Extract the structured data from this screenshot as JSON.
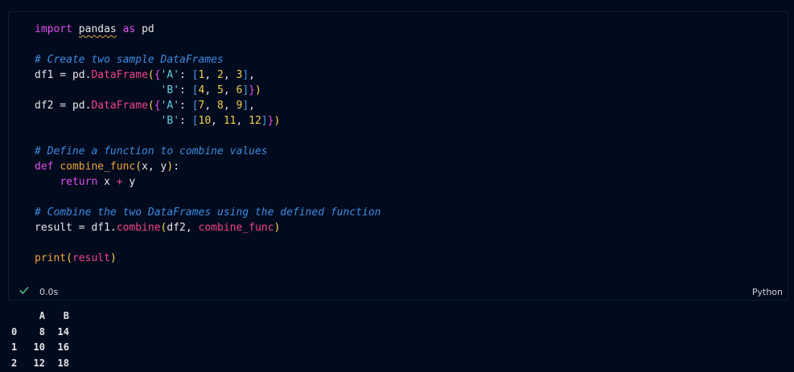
{
  "cell": {
    "code_lines": [
      [
        {
          "t": "import",
          "c": "kw"
        },
        {
          "t": " ",
          "c": "op"
        },
        {
          "t": "pandas",
          "c": "op squig"
        },
        {
          "t": " ",
          "c": "op"
        },
        {
          "t": "as",
          "c": "kw"
        },
        {
          "t": " pd",
          "c": "op"
        }
      ],
      [],
      [
        {
          "t": "# Create two sample DataFrames",
          "c": "cm"
        }
      ],
      [
        {
          "t": "df1 = pd.",
          "c": "op"
        },
        {
          "t": "DataFrame",
          "c": "mt"
        },
        {
          "t": "(",
          "c": "br1"
        },
        {
          "t": "{",
          "c": "br2"
        },
        {
          "t": "'A'",
          "c": "st"
        },
        {
          "t": ": ",
          "c": "op"
        },
        {
          "t": "[",
          "c": "br3"
        },
        {
          "t": "1",
          "c": "nu"
        },
        {
          "t": ", ",
          "c": "op"
        },
        {
          "t": "2",
          "c": "nu"
        },
        {
          "t": ", ",
          "c": "op"
        },
        {
          "t": "3",
          "c": "nu"
        },
        {
          "t": "]",
          "c": "br3"
        },
        {
          "t": ",",
          "c": "op"
        }
      ],
      [
        {
          "t": "                    ",
          "c": "op"
        },
        {
          "t": "'B'",
          "c": "st"
        },
        {
          "t": ": ",
          "c": "op"
        },
        {
          "t": "[",
          "c": "br3"
        },
        {
          "t": "4",
          "c": "nu"
        },
        {
          "t": ", ",
          "c": "op"
        },
        {
          "t": "5",
          "c": "nu"
        },
        {
          "t": ", ",
          "c": "op"
        },
        {
          "t": "6",
          "c": "nu"
        },
        {
          "t": "]",
          "c": "br3"
        },
        {
          "t": "}",
          "c": "br2"
        },
        {
          "t": ")",
          "c": "br1"
        }
      ],
      [
        {
          "t": "df2 = pd.",
          "c": "op"
        },
        {
          "t": "DataFrame",
          "c": "mt"
        },
        {
          "t": "(",
          "c": "br1"
        },
        {
          "t": "{",
          "c": "br2"
        },
        {
          "t": "'A'",
          "c": "st"
        },
        {
          "t": ": ",
          "c": "op"
        },
        {
          "t": "[",
          "c": "br3"
        },
        {
          "t": "7",
          "c": "nu"
        },
        {
          "t": ", ",
          "c": "op"
        },
        {
          "t": "8",
          "c": "nu"
        },
        {
          "t": ", ",
          "c": "op"
        },
        {
          "t": "9",
          "c": "nu"
        },
        {
          "t": "]",
          "c": "br3"
        },
        {
          "t": ",",
          "c": "op"
        }
      ],
      [
        {
          "t": "                    ",
          "c": "op"
        },
        {
          "t": "'B'",
          "c": "st"
        },
        {
          "t": ": ",
          "c": "op"
        },
        {
          "t": "[",
          "c": "br3"
        },
        {
          "t": "10",
          "c": "nu"
        },
        {
          "t": ", ",
          "c": "op"
        },
        {
          "t": "11",
          "c": "nu"
        },
        {
          "t": ", ",
          "c": "op"
        },
        {
          "t": "12",
          "c": "nu"
        },
        {
          "t": "]",
          "c": "br3"
        },
        {
          "t": "}",
          "c": "br2"
        },
        {
          "t": ")",
          "c": "br1"
        }
      ],
      [],
      [
        {
          "t": "# Define a function to combine values",
          "c": "cm"
        }
      ],
      [
        {
          "t": "def",
          "c": "kw"
        },
        {
          "t": " ",
          "c": "op"
        },
        {
          "t": "combine_func",
          "c": "fn"
        },
        {
          "t": "(",
          "c": "br1"
        },
        {
          "t": "x, y",
          "c": "op"
        },
        {
          "t": ")",
          "c": "br1"
        },
        {
          "t": ":",
          "c": "op"
        }
      ],
      [
        {
          "t": "    ",
          "c": "op"
        },
        {
          "t": "return",
          "c": "kw"
        },
        {
          "t": " x ",
          "c": "op"
        },
        {
          "t": "+",
          "c": "mt"
        },
        {
          "t": " y",
          "c": "op"
        }
      ],
      [],
      [
        {
          "t": "# Combine the two DataFrames using the defined function",
          "c": "cm"
        }
      ],
      [
        {
          "t": "result = df1.",
          "c": "op"
        },
        {
          "t": "combine",
          "c": "mt"
        },
        {
          "t": "(",
          "c": "br1"
        },
        {
          "t": "df2, ",
          "c": "op"
        },
        {
          "t": "combine_func",
          "c": "mt"
        },
        {
          "t": ")",
          "c": "br1"
        }
      ],
      [],
      [
        {
          "t": "print",
          "c": "fn"
        },
        {
          "t": "(",
          "c": "br1"
        },
        {
          "t": "result",
          "c": "mt"
        },
        {
          "t": ")",
          "c": "br1"
        }
      ]
    ],
    "status": {
      "check_icon": "check-icon",
      "duration": "0.0s",
      "language": "Python"
    }
  },
  "output": {
    "columns": [
      "",
      "A",
      "B"
    ],
    "rows": [
      [
        "0",
        "8",
        "14"
      ],
      [
        "1",
        "10",
        "16"
      ],
      [
        "2",
        "12",
        "18"
      ]
    ]
  },
  "colors": {
    "background": "#020a1d",
    "keyword": "#e04ef0",
    "comment": "#3c8ce2",
    "string": "#5fd4e0",
    "number": "#f2d24a",
    "success": "#4ec27a"
  }
}
